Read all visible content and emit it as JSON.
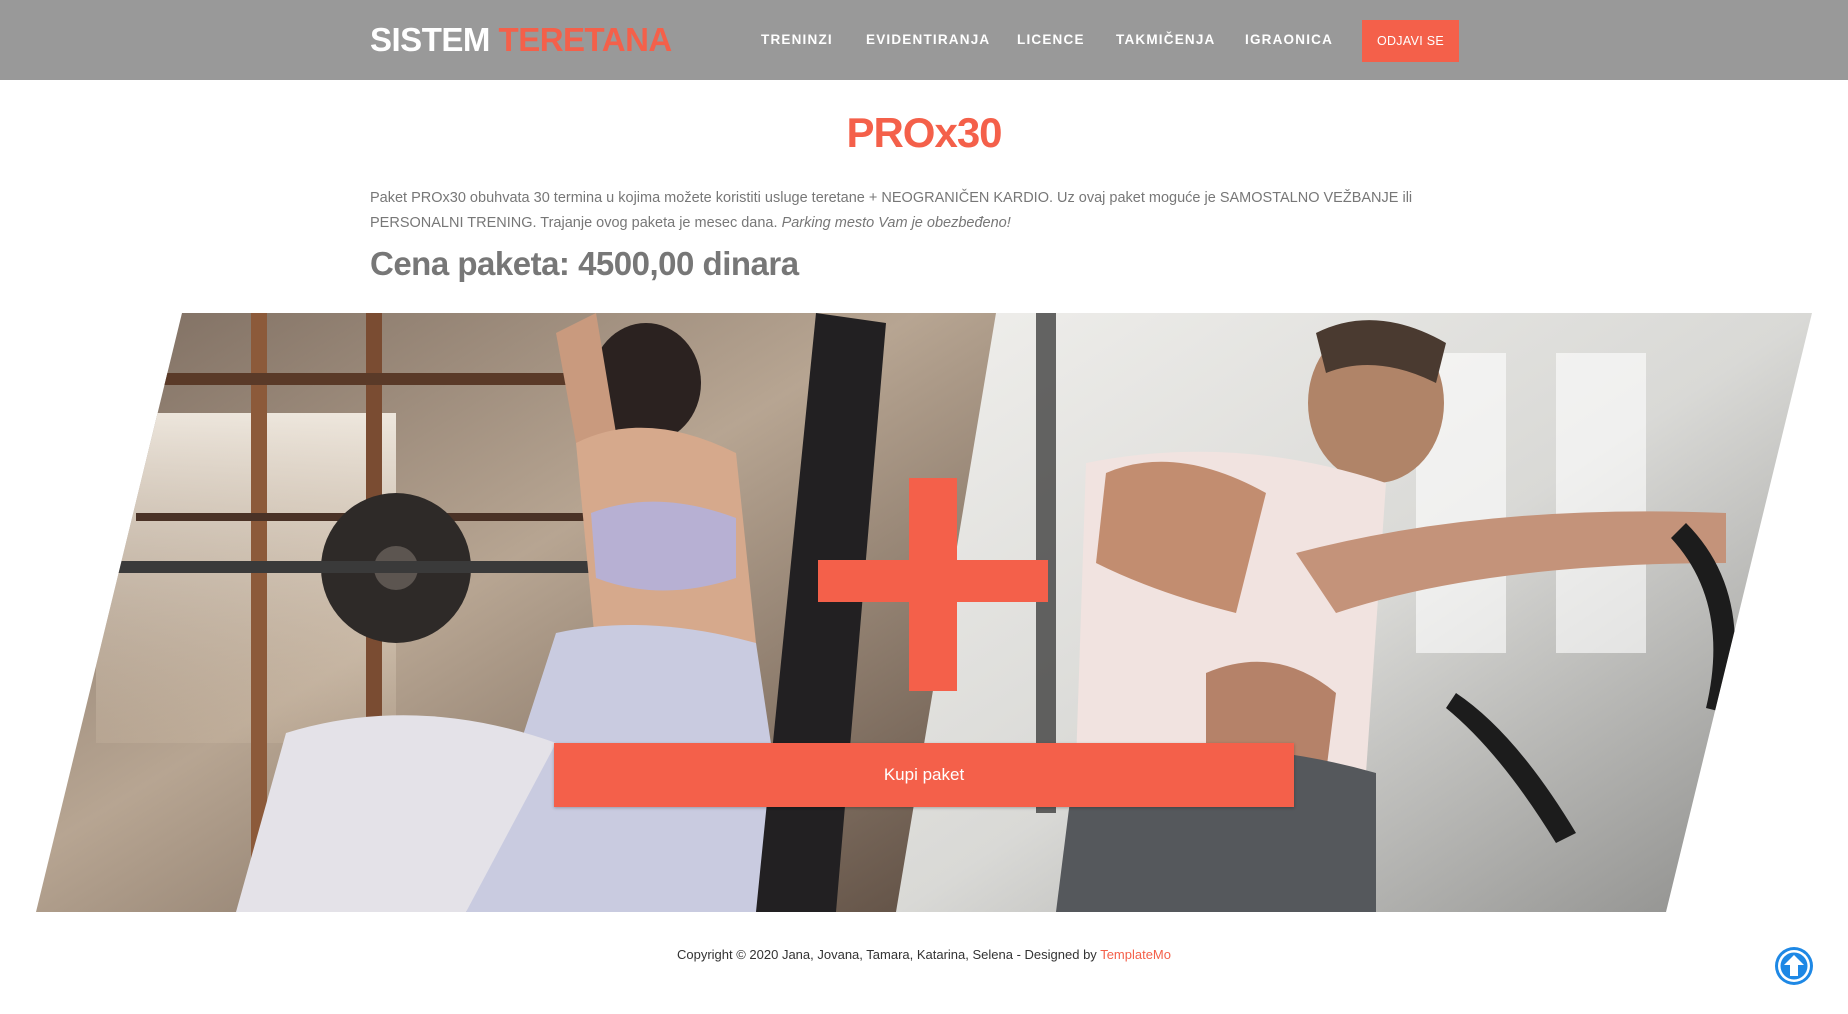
{
  "header": {
    "brand_part1": "SISTEM",
    "brand_part2": "TERETANA",
    "nav": [
      {
        "label": "TRENINZI"
      },
      {
        "label": "EVIDENTIRANJA"
      },
      {
        "label": "LICENCE"
      },
      {
        "label": "TAKMIČENJA"
      },
      {
        "label": "IGRAONICA"
      }
    ],
    "logout_label": "ODJAVI SE"
  },
  "main": {
    "title": "PROx30",
    "description": "Paket PROx30 obuhvata 30 termina u kojima možete koristiti usluge teretane + NEOGRANIČEN KARDIO. Uz ovaj paket moguće je SAMOSTALNO VEŽBANJE ili PERSONALNI TRENING. Trajanje ovog paketa je mesec dana.",
    "parking_note": "Parking mesto Vam je obezbeđeno!",
    "price_text": "Cena paketa: 4500,00 dinara",
    "buy_label": "Kupi paket"
  },
  "footer": {
    "copyright": "Copyright © 2020 Jana, Jovana, Tamara, Katarina, Selena - Designed by",
    "designer_link": "TemplateMo"
  },
  "colors": {
    "accent": "#f4604a",
    "header_bg": "#999999",
    "text_gray": "#777777",
    "scroll_top": "#1e88e5"
  },
  "icons": {
    "hero_plus": "plus-icon",
    "scroll_top": "arrow-up-circle-icon"
  }
}
